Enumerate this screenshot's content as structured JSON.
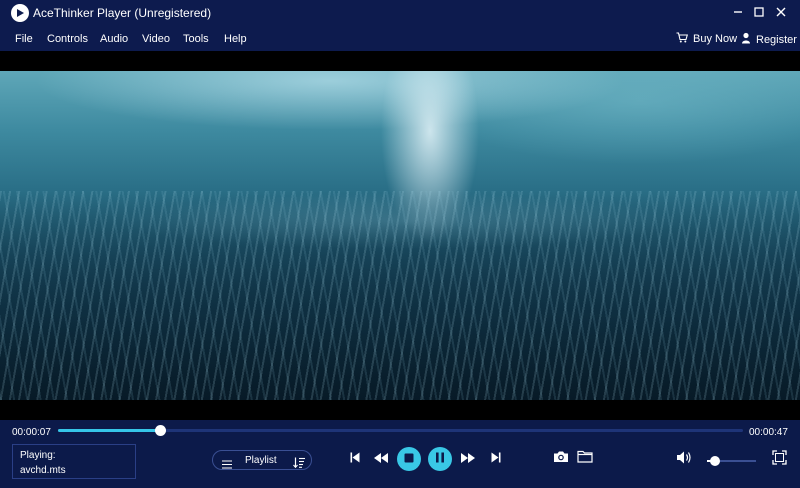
{
  "app": {
    "title": "AceThinker Player (Unregistered)"
  },
  "menu": {
    "items": [
      "File",
      "Controls",
      "Audio",
      "Video",
      "Tools",
      "Help"
    ],
    "buy_now": "Buy Now",
    "register": "Register"
  },
  "player": {
    "current_time": "00:00:07",
    "total_time": "00:00:47",
    "progress": 0.149,
    "now_playing_label": "Playing:",
    "now_playing_file": "avchd.mts",
    "playlist_label": "Playlist",
    "volume": 0.1
  },
  "colors": {
    "background": "#0c1a4a",
    "accent": "#39c8e6"
  },
  "icons": {
    "logo": "play-logo-icon",
    "minimize": "minimize-icon",
    "maximize": "maximize-icon",
    "close": "close-icon",
    "cart": "cart-icon",
    "user": "user-icon",
    "prev": "skip-previous-icon",
    "rewind": "rewind-icon",
    "stop": "stop-icon",
    "pause": "pause-icon",
    "forward": "fast-forward-icon",
    "next": "skip-next-icon",
    "snapshot": "camera-icon",
    "folder": "folder-icon",
    "volume": "volume-icon",
    "fullscreen": "fullscreen-icon",
    "playlist": "list-icon",
    "sort": "sort-icon"
  }
}
